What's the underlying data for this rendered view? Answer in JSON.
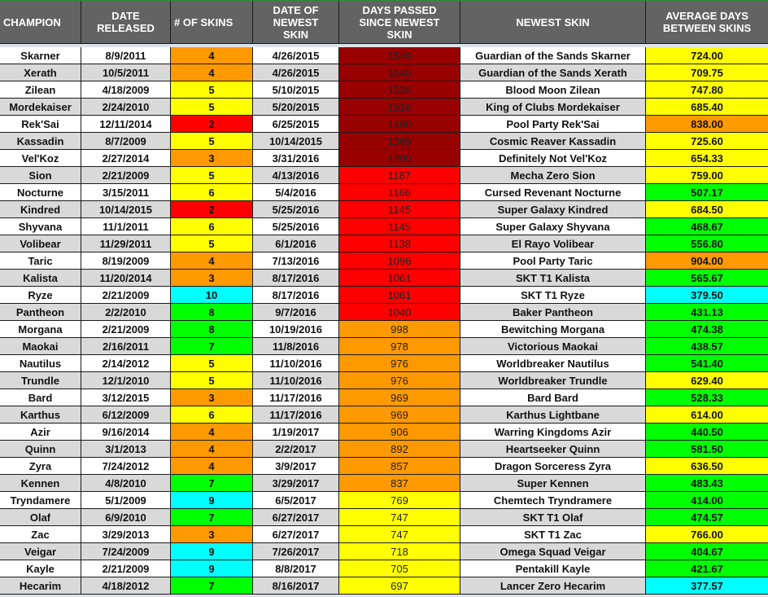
{
  "colors": {
    "header_bg": "#636363",
    "row_white": "#ffffff",
    "row_gray": "#d9d9d9",
    "dark_red": "#990000",
    "red": "#ff0000",
    "orange": "#ff9900",
    "yellow": "#ffff00",
    "green": "#00ff00",
    "cyan": "#00ffff"
  },
  "headers": [
    "CHAMPION",
    "DATE\nRELEASED",
    "# OF SKINS",
    "DATE OF\nNEWEST\nSKIN",
    "DAYS PASSED\nSINCE NEWEST\nSKIN",
    "NEWEST SKIN",
    "AVERAGE DAYS\nBETWEEN SKINS"
  ],
  "rows": [
    {
      "champion": "Skarner",
      "released": "8/9/2011",
      "skins": "4",
      "skins_color": "orange",
      "newest_date": "4/26/2015",
      "days": "1540",
      "days_color": "dark_red",
      "newest_skin": "Guardian of the Sands Skarner",
      "avg": "724.00",
      "avg_color": "yellow"
    },
    {
      "champion": "Xerath",
      "released": "10/5/2011",
      "skins": "4",
      "skins_color": "orange",
      "newest_date": "4/26/2015",
      "days": "1540",
      "days_color": "dark_red",
      "newest_skin": "Guardian of the Sands Xerath",
      "avg": "709.75",
      "avg_color": "yellow"
    },
    {
      "champion": "Zilean",
      "released": "4/18/2009",
      "skins": "5",
      "skins_color": "yellow",
      "newest_date": "5/10/2015",
      "days": "1526",
      "days_color": "dark_red",
      "newest_skin": "Blood Moon Zilean",
      "avg": "747.80",
      "avg_color": "yellow"
    },
    {
      "champion": "Mordekaiser",
      "released": "2/24/2010",
      "skins": "5",
      "skins_color": "yellow",
      "newest_date": "5/20/2015",
      "days": "1516",
      "days_color": "dark_red",
      "newest_skin": "King of Clubs Mordekaiser",
      "avg": "685.40",
      "avg_color": "yellow"
    },
    {
      "champion": "Rek'Sai",
      "released": "12/11/2014",
      "skins": "2",
      "skins_color": "red",
      "newest_date": "6/25/2015",
      "days": "1480",
      "days_color": "dark_red",
      "newest_skin": "Pool Party Rek'Sai",
      "avg": "838.00",
      "avg_color": "orange"
    },
    {
      "champion": "Kassadin",
      "released": "8/7/2009",
      "skins": "5",
      "skins_color": "yellow",
      "newest_date": "10/14/2015",
      "days": "1369",
      "days_color": "dark_red",
      "newest_skin": "Cosmic Reaver Kassadin",
      "avg": "725.60",
      "avg_color": "yellow"
    },
    {
      "champion": "Vel'Koz",
      "released": "2/27/2014",
      "skins": "3",
      "skins_color": "orange",
      "newest_date": "3/31/2016",
      "days": "1200",
      "days_color": "dark_red",
      "newest_skin": "Definitely Not Vel'Koz",
      "avg": "654.33",
      "avg_color": "yellow"
    },
    {
      "champion": "Sion",
      "released": "2/21/2009",
      "skins": "5",
      "skins_color": "yellow",
      "newest_date": "4/13/2016",
      "days": "1187",
      "days_color": "red",
      "newest_skin": "Mecha Zero Sion",
      "avg": "759.00",
      "avg_color": "yellow"
    },
    {
      "champion": "Nocturne",
      "released": "3/15/2011",
      "skins": "6",
      "skins_color": "yellow",
      "newest_date": "5/4/2016",
      "days": "1166",
      "days_color": "red",
      "newest_skin": "Cursed Revenant Nocturne",
      "avg": "507.17",
      "avg_color": "green"
    },
    {
      "champion": "Kindred",
      "released": "10/14/2015",
      "skins": "2",
      "skins_color": "red",
      "newest_date": "5/25/2016",
      "days": "1145",
      "days_color": "red",
      "newest_skin": "Super Galaxy Kindred",
      "avg": "684.50",
      "avg_color": "yellow"
    },
    {
      "champion": "Shyvana",
      "released": "11/1/2011",
      "skins": "6",
      "skins_color": "yellow",
      "newest_date": "5/25/2016",
      "days": "1145",
      "days_color": "red",
      "newest_skin": "Super Galaxy Shyvana",
      "avg": "468.67",
      "avg_color": "green"
    },
    {
      "champion": "Volibear",
      "released": "11/29/2011",
      "skins": "5",
      "skins_color": "yellow",
      "newest_date": "6/1/2016",
      "days": "1138",
      "days_color": "red",
      "newest_skin": "El Rayo Volibear",
      "avg": "556.80",
      "avg_color": "green"
    },
    {
      "champion": "Taric",
      "released": "8/19/2009",
      "skins": "4",
      "skins_color": "orange",
      "newest_date": "7/13/2016",
      "days": "1096",
      "days_color": "red",
      "newest_skin": "Pool Party Taric",
      "avg": "904.00",
      "avg_color": "orange"
    },
    {
      "champion": "Kalista",
      "released": "11/20/2014",
      "skins": "3",
      "skins_color": "orange",
      "newest_date": "8/17/2016",
      "days": "1061",
      "days_color": "red",
      "newest_skin": "SKT T1 Kalista",
      "avg": "565.67",
      "avg_color": "green"
    },
    {
      "champion": "Ryze",
      "released": "2/21/2009",
      "skins": "10",
      "skins_color": "cyan",
      "newest_date": "8/17/2016",
      "days": "1061",
      "days_color": "red",
      "newest_skin": "SKT T1 Ryze",
      "avg": "379.50",
      "avg_color": "cyan"
    },
    {
      "champion": "Pantheon",
      "released": "2/2/2010",
      "skins": "8",
      "skins_color": "green",
      "newest_date": "9/7/2016",
      "days": "1040",
      "days_color": "red",
      "newest_skin": "Baker Pantheon",
      "avg": "431.13",
      "avg_color": "green"
    },
    {
      "champion": "Morgana",
      "released": "2/21/2009",
      "skins": "8",
      "skins_color": "green",
      "newest_date": "10/19/2016",
      "days": "998",
      "days_color": "orange",
      "newest_skin": "Bewitching Morgana",
      "avg": "474.38",
      "avg_color": "green"
    },
    {
      "champion": "Maokai",
      "released": "2/16/2011",
      "skins": "7",
      "skins_color": "green",
      "newest_date": "11/8/2016",
      "days": "978",
      "days_color": "orange",
      "newest_skin": "Victorious Maokai",
      "avg": "438.57",
      "avg_color": "green"
    },
    {
      "champion": "Nautilus",
      "released": "2/14/2012",
      "skins": "5",
      "skins_color": "yellow",
      "newest_date": "11/10/2016",
      "days": "976",
      "days_color": "orange",
      "newest_skin": "Worldbreaker Nautilus",
      "avg": "541.40",
      "avg_color": "green"
    },
    {
      "champion": "Trundle",
      "released": "12/1/2010",
      "skins": "5",
      "skins_color": "yellow",
      "newest_date": "11/10/2016",
      "days": "976",
      "days_color": "orange",
      "newest_skin": "Worldbreaker Trundle",
      "avg": "629.40",
      "avg_color": "yellow"
    },
    {
      "champion": "Bard",
      "released": "3/12/2015",
      "skins": "3",
      "skins_color": "orange",
      "newest_date": "11/17/2016",
      "days": "969",
      "days_color": "orange",
      "newest_skin": "Bard Bard",
      "avg": "528.33",
      "avg_color": "green"
    },
    {
      "champion": "Karthus",
      "released": "6/12/2009",
      "skins": "6",
      "skins_color": "yellow",
      "newest_date": "11/17/2016",
      "days": "969",
      "days_color": "orange",
      "newest_skin": "Karthus Lightbane",
      "avg": "614.00",
      "avg_color": "yellow"
    },
    {
      "champion": "Azir",
      "released": "9/16/2014",
      "skins": "4",
      "skins_color": "orange",
      "newest_date": "1/19/2017",
      "days": "906",
      "days_color": "orange",
      "newest_skin": "Warring Kingdoms Azir",
      "avg": "440.50",
      "avg_color": "green"
    },
    {
      "champion": "Quinn",
      "released": "3/1/2013",
      "skins": "4",
      "skins_color": "orange",
      "newest_date": "2/2/2017",
      "days": "892",
      "days_color": "orange",
      "newest_skin": "Heartseeker Quinn",
      "avg": "581.50",
      "avg_color": "green"
    },
    {
      "champion": "Zyra",
      "released": "7/24/2012",
      "skins": "4",
      "skins_color": "orange",
      "newest_date": "3/9/2017",
      "days": "857",
      "days_color": "orange",
      "newest_skin": "Dragon Sorceress Zyra",
      "avg": "636.50",
      "avg_color": "yellow"
    },
    {
      "champion": "Kennen",
      "released": "4/8/2010",
      "skins": "7",
      "skins_color": "green",
      "newest_date": "3/29/2017",
      "days": "837",
      "days_color": "orange",
      "newest_skin": "Super Kennen",
      "avg": "483.43",
      "avg_color": "green"
    },
    {
      "champion": "Tryndamere",
      "released": "5/1/2009",
      "skins": "9",
      "skins_color": "cyan",
      "newest_date": "6/5/2017",
      "days": "769",
      "days_color": "yellow",
      "newest_skin": "Chemtech Tryndramere",
      "avg": "414.00",
      "avg_color": "green"
    },
    {
      "champion": "Olaf",
      "released": "6/9/2010",
      "skins": "7",
      "skins_color": "green",
      "newest_date": "6/27/2017",
      "days": "747",
      "days_color": "yellow",
      "newest_skin": "SKT T1 Olaf",
      "avg": "474.57",
      "avg_color": "green"
    },
    {
      "champion": "Zac",
      "released": "3/29/2013",
      "skins": "3",
      "skins_color": "orange",
      "newest_date": "6/27/2017",
      "days": "747",
      "days_color": "yellow",
      "newest_skin": "SKT T1 Zac",
      "avg": "766.00",
      "avg_color": "yellow"
    },
    {
      "champion": "Veigar",
      "released": "7/24/2009",
      "skins": "9",
      "skins_color": "cyan",
      "newest_date": "7/26/2017",
      "days": "718",
      "days_color": "yellow",
      "newest_skin": "Omega Squad Veigar",
      "avg": "404.67",
      "avg_color": "green"
    },
    {
      "champion": "Kayle",
      "released": "2/21/2009",
      "skins": "9",
      "skins_color": "cyan",
      "newest_date": "8/8/2017",
      "days": "705",
      "days_color": "yellow",
      "newest_skin": "Pentakill Kayle",
      "avg": "421.67",
      "avg_color": "green"
    },
    {
      "champion": "Hecarim",
      "released": "4/18/2012",
      "skins": "7",
      "skins_color": "green",
      "newest_date": "8/16/2017",
      "days": "697",
      "days_color": "yellow",
      "newest_skin": "Lancer Zero Hecarim",
      "avg": "377.57",
      "avg_color": "cyan"
    }
  ]
}
